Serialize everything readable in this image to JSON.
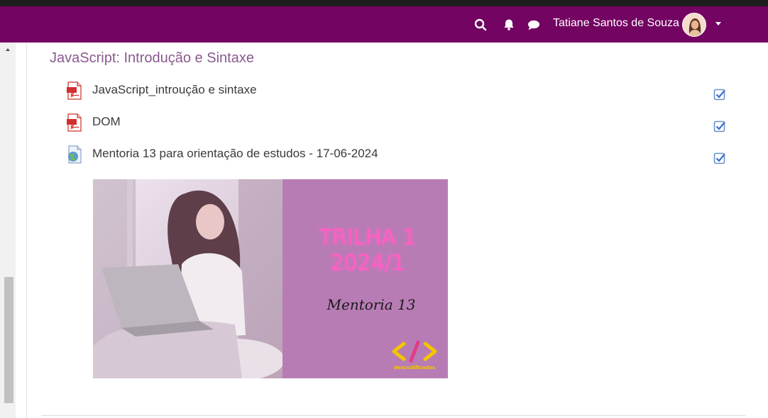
{
  "header": {
    "user_name": "Tatiane Santos de Souza",
    "icons": [
      "search-icon",
      "bell-icon",
      "chat-icon",
      "chevron-down-icon"
    ],
    "bg_color": "#730462"
  },
  "section": {
    "title": "JavaScript: Introdução e Sintaxe",
    "activities": [
      {
        "label": "JavaScript_introução e sintaxe",
        "icon": "pdf-icon",
        "completed": true
      },
      {
        "label": "DOM",
        "icon": "pdf-icon",
        "completed": true
      },
      {
        "label": "Mentoria 13 para orientação de estudos - 17-06-2024",
        "icon": "url-icon",
        "completed": true
      }
    ]
  },
  "banner": {
    "trilha_line1": "TRILHA 1",
    "trilha_line2": "2024/1",
    "mentoria": "Mentoria 13",
    "logo_text": "descodificadas"
  }
}
